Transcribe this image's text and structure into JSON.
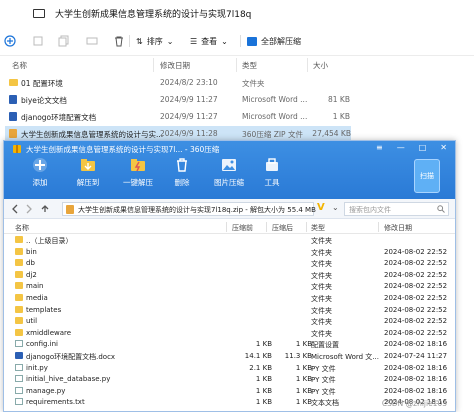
{
  "explorer": {
    "path": "大学生创新成果信息管理系统的设计与实现7l18q",
    "toolbar": {
      "sort_label": "排序",
      "view_label": "查看",
      "extract_label": "全部解压缩"
    },
    "columns": {
      "name": "名称",
      "date": "修改日期",
      "type": "类型",
      "size": "大小"
    },
    "files": [
      {
        "name": "01 配置环境",
        "date": "2024/8/2 23:10",
        "type": "文件夹",
        "size": "",
        "icon": "folder-icon"
      },
      {
        "name": "biye论文文档",
        "date": "2024/9/9 11:27",
        "type": "Microsoft Word ...",
        "size": "81 KB",
        "icon": "word-file-icon"
      },
      {
        "name": "djanogo环境配置文档",
        "date": "2024/9/9 11:27",
        "type": "Microsoft Word ...",
        "size": "1 KB",
        "icon": "word-file-icon"
      },
      {
        "name": "大学生创新成果信息管理系统的设计与实...",
        "date": "2024/9/9 11:28",
        "type": "360压缩 ZIP 文件",
        "size": "27,454 KB",
        "icon": "zip-file-icon"
      }
    ]
  },
  "zip": {
    "title": "大学生创新成果信息管理系统的设计与实现7l... - 360压缩",
    "window_buttons": [
      "≡",
      "—",
      "□",
      "✕"
    ],
    "tools": [
      {
        "label": "添加",
        "icon": "add-icon"
      },
      {
        "label": "解压到",
        "icon": "extract-to-icon"
      },
      {
        "label": "一键解压",
        "icon": "one-click-extract-icon"
      },
      {
        "label": "删除",
        "icon": "delete-icon"
      },
      {
        "label": "图片压缩",
        "icon": "image-compress-icon"
      },
      {
        "label": "工具",
        "icon": "tools-icon"
      }
    ],
    "scan_label": "扫描",
    "address": "大学生创新成果信息管理系统的设计与实现7l18q.zip - 解包大小为 55.4 MB",
    "search_placeholder": "搜索包内文件",
    "columns": {
      "name": "名称",
      "size": "压缩前",
      "csize": "压缩后",
      "type": "类型",
      "date": "修改日期"
    },
    "files": [
      {
        "name": "..（上级目录）",
        "size": "",
        "csize": "",
        "type": "文件夹",
        "date": "",
        "kind": "up"
      },
      {
        "name": "bin",
        "size": "",
        "csize": "",
        "type": "文件夹",
        "date": "2024-08-02 22:52",
        "kind": "folder"
      },
      {
        "name": "db",
        "size": "",
        "csize": "",
        "type": "文件夹",
        "date": "2024-08-02 22:52",
        "kind": "folder"
      },
      {
        "name": "dj2",
        "size": "",
        "csize": "",
        "type": "文件夹",
        "date": "2024-08-02 22:52",
        "kind": "folder"
      },
      {
        "name": "main",
        "size": "",
        "csize": "",
        "type": "文件夹",
        "date": "2024-08-02 22:52",
        "kind": "folder"
      },
      {
        "name": "media",
        "size": "",
        "csize": "",
        "type": "文件夹",
        "date": "2024-08-02 22:52",
        "kind": "folder"
      },
      {
        "name": "templates",
        "size": "",
        "csize": "",
        "type": "文件夹",
        "date": "2024-08-02 22:52",
        "kind": "folder"
      },
      {
        "name": "util",
        "size": "",
        "csize": "",
        "type": "文件夹",
        "date": "2024-08-02 22:52",
        "kind": "folder"
      },
      {
        "name": "xmiddleware",
        "size": "",
        "csize": "",
        "type": "文件夹",
        "date": "2024-08-02 22:52",
        "kind": "folder"
      },
      {
        "name": "config.ini",
        "size": "1 KB",
        "csize": "1 KB",
        "type": "配置设置",
        "date": "2024-08-02 18:16",
        "kind": "doc"
      },
      {
        "name": "djanogo环境配置文档.docx",
        "size": "14.1 KB",
        "csize": "11.3 KB",
        "type": "Microsoft Word 文...",
        "date": "2024-07-24 11:27",
        "kind": "word"
      },
      {
        "name": "init.py",
        "size": "2.1 KB",
        "csize": "1 KB",
        "type": "PY 文件",
        "date": "2024-08-02 18:16",
        "kind": "py"
      },
      {
        "name": "initial_hive_database.py",
        "size": "1 KB",
        "csize": "1 KB",
        "type": "PY 文件",
        "date": "2024-08-02 18:16",
        "kind": "py"
      },
      {
        "name": "manage.py",
        "size": "1 KB",
        "csize": "1 KB",
        "type": "PY 文件",
        "date": "2024-08-02 18:16",
        "kind": "py"
      },
      {
        "name": "requirements.txt",
        "size": "1 KB",
        "csize": "1 KB",
        "type": "文本文档",
        "date": "2024-08-02 18:16",
        "kind": "txt"
      }
    ]
  },
  "watermark": "CSDN @zhijie103"
}
